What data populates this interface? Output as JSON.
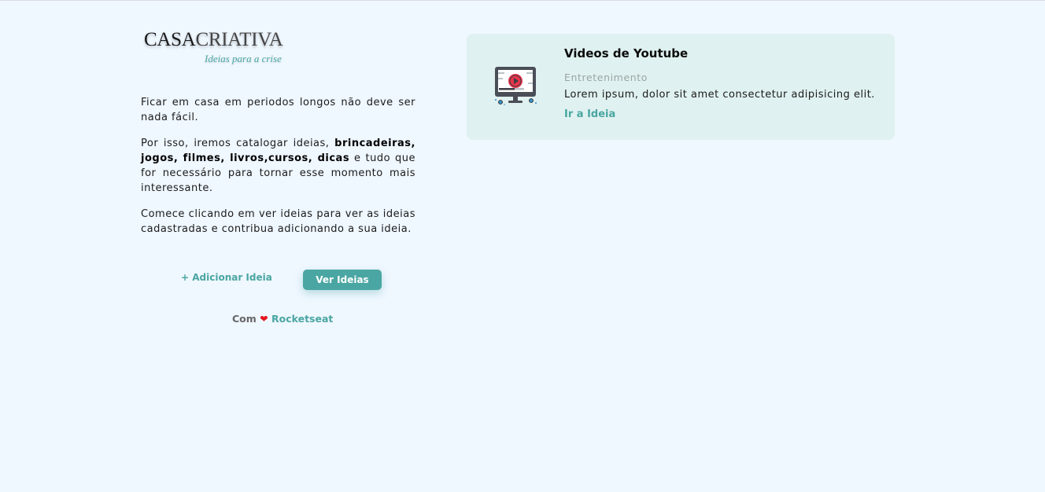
{
  "logo": {
    "word_bold": "CASA",
    "word_light": "CRIATIVA",
    "tagline": "Ideias para a crise"
  },
  "intro": {
    "p1": "Ficar em casa em periodos longos não deve ser nada fácil.",
    "p2_start": "Por isso, iremos catalogar ideias, ",
    "p2_bold": "brincadeiras, jogos, filmes, livros,cursos, dicas",
    "p2_end": " e tudo que for necessário para tornar esse momento mais interessante.",
    "p3": "Comece clicando em ver ideias para ver as ideias cadastradas e contribua adicionando a sua ideia."
  },
  "actions": {
    "add_label": "+ Adicionar Ideia",
    "view_label": "Ver Ideias"
  },
  "footer": {
    "prefix": "Com",
    "heart": "❤",
    "brand": "Rocketseat"
  },
  "ideas": [
    {
      "icon": "monitor-video-icon",
      "title": "Videos de Youtube",
      "category": "Entretenimento",
      "description": "Lorem ipsum, dolor sit amet consectetur adipisicing elit.",
      "link_label": "Ir a Ideia"
    }
  ],
  "colors": {
    "background": "#eff7ff",
    "accent": "#4aa6a2",
    "card": "#dff1f0",
    "heart": "#e5151b"
  }
}
